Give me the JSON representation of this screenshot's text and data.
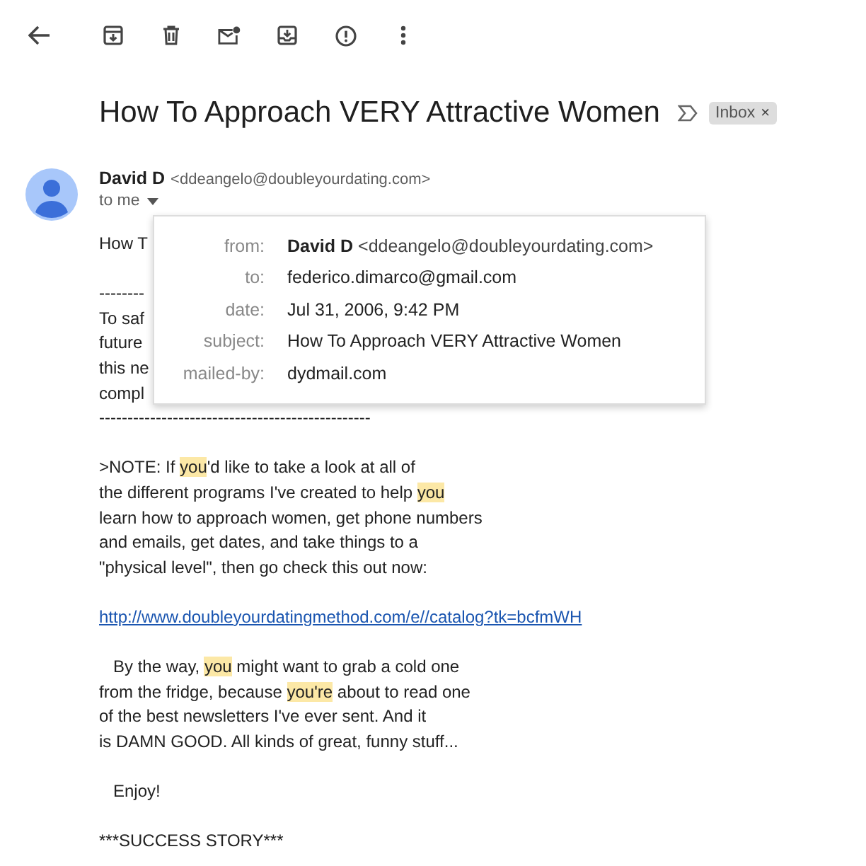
{
  "toolbar": {
    "buttons": [
      {
        "kind": "back"
      },
      {
        "kind": "archive"
      },
      {
        "kind": "delete"
      },
      {
        "kind": "unread"
      },
      {
        "kind": "move"
      },
      {
        "kind": "spam"
      },
      {
        "kind": "more"
      }
    ]
  },
  "subject": "How To Approach VERY Attractive Women",
  "label": {
    "text": "Inbox",
    "close": "×"
  },
  "sender": {
    "name": "David D",
    "email": "<ddeangelo@doubleyourdating.com>",
    "recipients": "to me"
  },
  "details": [
    {
      "key": "from:",
      "value": "David D",
      "extra": "<ddeangelo@doubleyourdating.com>"
    },
    {
      "key": "to:",
      "value": "federico.dimarco@gmail.com"
    },
    {
      "key": "date:",
      "value": "Jul 31, 2006, 9:42 PM"
    },
    {
      "key": "subject:",
      "value": "How To Approach VERY Attractive Women"
    },
    {
      "key": "mailed-by:",
      "value": "dydmail.com"
    }
  ],
  "body": [
    {
      "kind": "text",
      "segments": [
        {
          "text": "How T",
          "highlight": false
        }
      ]
    },
    {
      "kind": "blank"
    },
    {
      "kind": "text",
      "segments": [
        {
          "text": "--------",
          "highlight": false
        }
      ]
    },
    {
      "kind": "text",
      "segments": [
        {
          "text": "To saf",
          "highlight": false
        }
      ]
    },
    {
      "kind": "text",
      "segments": [
        {
          "text": "future",
          "highlight": false
        }
      ]
    },
    {
      "kind": "text",
      "segments": [
        {
          "text": "this ne",
          "highlight": false
        }
      ]
    },
    {
      "kind": "text",
      "segments": [
        {
          "text": "compl",
          "highlight": false
        }
      ]
    },
    {
      "kind": "text",
      "segments": [
        {
          "text": "------------------------------------------------",
          "highlight": false
        }
      ]
    },
    {
      "kind": "blank"
    },
    {
      "kind": "text",
      "segments": [
        {
          "text": ">NOTE: If ",
          "highlight": false
        },
        {
          "text": "you",
          "highlight": true
        },
        {
          "text": "'d like to take a look at all of",
          "highlight": false
        }
      ]
    },
    {
      "kind": "text",
      "segments": [
        {
          "text": "the different programs I've created to help ",
          "highlight": false
        },
        {
          "text": "you",
          "highlight": true
        }
      ]
    },
    {
      "kind": "text",
      "segments": [
        {
          "text": "learn how to approach women, get phone numbers",
          "highlight": false
        }
      ]
    },
    {
      "kind": "text",
      "segments": [
        {
          "text": "and emails, get dates, and take things to a",
          "highlight": false
        }
      ]
    },
    {
      "kind": "text",
      "segments": [
        {
          "text": "\"physical level\", then go check this out now:",
          "highlight": false
        }
      ]
    },
    {
      "kind": "blank"
    },
    {
      "kind": "link",
      "text": "http://www.doubleyourdatingmethod.com/e//catalog?tk=bcfmWH"
    },
    {
      "kind": "blank"
    },
    {
      "kind": "text",
      "segments": [
        {
          "text": "   By the way, ",
          "highlight": false
        },
        {
          "text": "you",
          "highlight": true
        },
        {
          "text": " might want to grab a cold one",
          "highlight": false
        }
      ]
    },
    {
      "kind": "text",
      "segments": [
        {
          "text": "from the fridge, because ",
          "highlight": false
        },
        {
          "text": "you're",
          "highlight": true
        },
        {
          "text": " about to read one",
          "highlight": false
        }
      ]
    },
    {
      "kind": "text",
      "segments": [
        {
          "text": "of the best newsletters I've ever sent. And it",
          "highlight": false
        }
      ]
    },
    {
      "kind": "text",
      "segments": [
        {
          "text": "is DAMN GOOD. All kinds of great, funny stuff...",
          "highlight": false
        }
      ]
    },
    {
      "kind": "blank"
    },
    {
      "kind": "text",
      "segments": [
        {
          "text": "   Enjoy!",
          "highlight": false
        }
      ]
    },
    {
      "kind": "blank"
    },
    {
      "kind": "text",
      "segments": [
        {
          "text": "***SUCCESS STORY***",
          "highlight": false
        }
      ]
    }
  ]
}
